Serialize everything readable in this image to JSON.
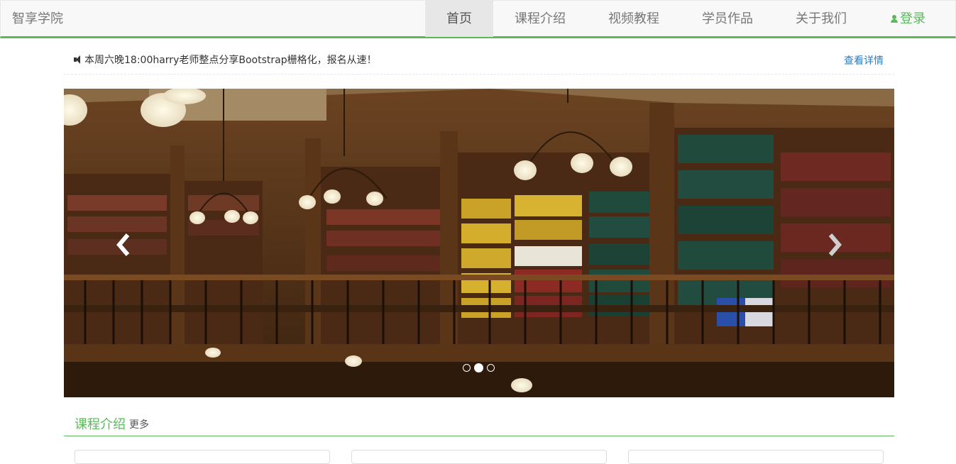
{
  "navbar": {
    "brand": "智享学院",
    "items": [
      {
        "label": "首页",
        "active": true
      },
      {
        "label": "课程介绍"
      },
      {
        "label": "视频教程"
      },
      {
        "label": "学员作品"
      },
      {
        "label": "关于我们"
      }
    ],
    "login_label": "登录",
    "accent": "#5cb85c"
  },
  "notice": {
    "text": "本周六晚18:00harry老师整点分享Bootstrap栅格化，报名从速！",
    "link": "查看详情"
  },
  "carousel": {
    "slide_image": "library-interior",
    "prev_icon": "chevron-left-icon",
    "next_icon": "chevron-right-icon",
    "slide_count": 3,
    "active_index": 1
  },
  "section": {
    "title": "课程介绍",
    "more": "更多"
  }
}
